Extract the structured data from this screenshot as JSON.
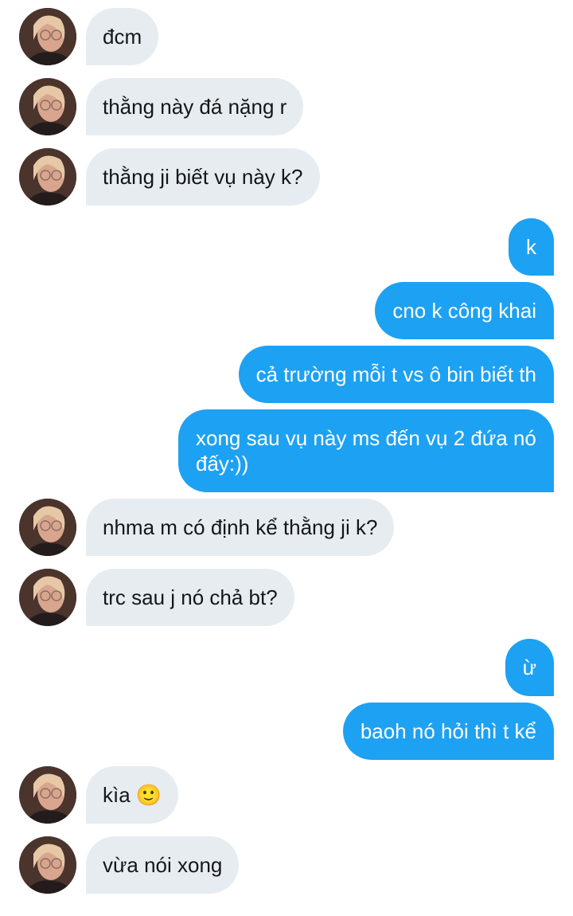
{
  "conversation": {
    "messages": [
      {
        "side": "in",
        "text": "đcm"
      },
      {
        "side": "in",
        "text": "thằng này đá nặng r"
      },
      {
        "side": "in",
        "text": "thằng ji biết vụ này k?"
      },
      {
        "side": "out",
        "text": "k"
      },
      {
        "side": "out",
        "text": "cno k công khai"
      },
      {
        "side": "out",
        "text": "cả trường mỗi t vs ô bin biết th"
      },
      {
        "side": "out",
        "text": "xong sau vụ này ms đến vụ 2 đứa nó đấy:))"
      },
      {
        "side": "in",
        "text": "nhma m có định kể thằng ji k?"
      },
      {
        "side": "in",
        "text": "trc sau j nó chả bt?"
      },
      {
        "side": "out",
        "text": "ừ"
      },
      {
        "side": "out",
        "text": "baoh nó hỏi thì t kể"
      },
      {
        "side": "in",
        "text": "kìa 🙂"
      },
      {
        "side": "in",
        "text": "vừa nói xong"
      }
    ]
  },
  "colors": {
    "incoming_bubble": "#e6ecf0",
    "outgoing_bubble": "#1da1f2",
    "incoming_text": "#14171a",
    "outgoing_text": "#ffffff"
  },
  "icons": {
    "avatar": "user-avatar-photo"
  }
}
